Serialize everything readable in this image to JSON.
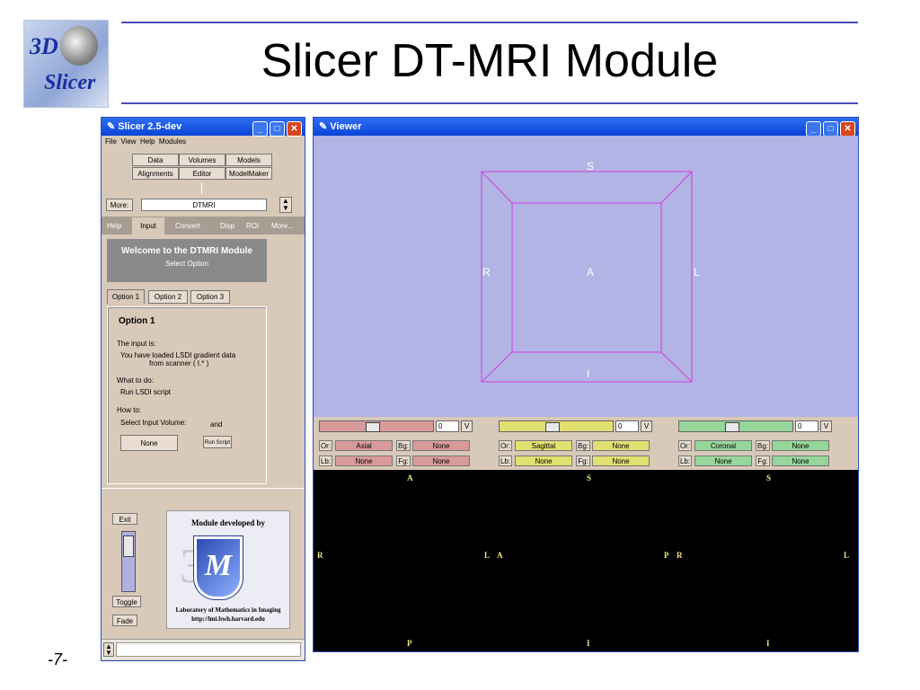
{
  "slide": {
    "title": "Slicer DT-MRI Module",
    "page_number": "-7-",
    "logo_top": "3D",
    "logo_bottom": "Slicer"
  },
  "left_window": {
    "title": "Slicer 2.5-dev",
    "menu": [
      "File",
      "View",
      "Help",
      "Modules"
    ],
    "module_buttons": [
      "Data",
      "Volumes",
      "Models",
      "Alignments",
      "Editor",
      "ModelMaker"
    ],
    "more_label": "More:",
    "module_select": "DTMRI",
    "tabs": [
      "Help",
      "Input",
      "Convert",
      "Disp",
      "ROI",
      "More..."
    ],
    "active_tab": "Input",
    "welcome_title": "Welcome to the DTMRI Module",
    "welcome_subtitle": "Select Option",
    "option_tabs": [
      "Option 1",
      "Option 2",
      "Option 3"
    ],
    "option_heading": "Option 1",
    "input_label": "The input is:",
    "input_text_1": "You have loaded LSDI gradient data",
    "input_text_2": "from scanner ( I.* )",
    "todo_label": "What to do:",
    "todo_text": "Run LSDI script",
    "how_label": "How to:",
    "select_volume_label": "Select Input Volume:",
    "and_label": "and",
    "none_button": "None",
    "run_script_button": "Run Script",
    "exit_button": "Exit",
    "toggle_button": "Toggle",
    "fade_button": "Fade",
    "credit_top": "Module developed by",
    "credit_line1": "Laboratory of Mathematics in Imaging",
    "credit_line2": "http://lmi.bwh.harvard.edu",
    "credit_logo_text": "3L"
  },
  "viewer": {
    "title": "Viewer",
    "labels_3d": {
      "top": "S",
      "bottom": "I",
      "left": "R",
      "right": "L",
      "center": "A"
    },
    "panels": [
      {
        "or_label": "Or:",
        "orientation": "Axial",
        "bg_label": "Bg:",
        "bg": "None",
        "lb_label": "Lb:",
        "lb": "None",
        "fg_label": "Fg:",
        "fg": "None",
        "offset": "0",
        "v_label": "V",
        "slider_pos": 0.5,
        "orient": {
          "top": "A",
          "bottom": "P",
          "left": "R",
          "right": "L"
        }
      },
      {
        "or_label": "Or:",
        "orientation": "Sagittal",
        "bg_label": "Bg:",
        "bg": "None",
        "lb_label": "Lb:",
        "lb": "None",
        "fg_label": "Fg:",
        "fg": "None",
        "offset": "0",
        "v_label": "V",
        "slider_pos": 0.5,
        "orient": {
          "top": "S",
          "bottom": "I",
          "left": "A",
          "right": "P"
        }
      },
      {
        "or_label": "Or:",
        "orientation": "Coronal",
        "bg_label": "Bg:",
        "bg": "None",
        "lb_label": "Lb:",
        "lb": "None",
        "fg_label": "Fg:",
        "fg": "None",
        "offset": "0",
        "v_label": "V",
        "slider_pos": 0.5,
        "orient": {
          "top": "S",
          "bottom": "I",
          "left": "R",
          "right": "L"
        }
      }
    ]
  },
  "colors": {
    "axial": "#d99a9a",
    "sagittal": "#e2e070",
    "coronal": "#96d69a",
    "viewer_bg": "#b1b4e4",
    "box": "#d23be0"
  }
}
